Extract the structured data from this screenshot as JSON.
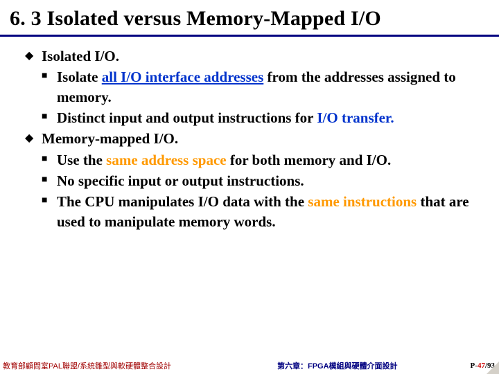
{
  "title": "6. 3 Isolated versus Memory-Mapped I/O",
  "items": [
    {
      "label": "Isolated I/O.",
      "sub": [
        {
          "parts": [
            {
              "t": "Isolate ",
              "c": ""
            },
            {
              "t": "all I/O interface addresses",
              "c": "hl-blue ul"
            },
            {
              "t": " from the addresses assigned to memory.",
              "c": ""
            }
          ]
        },
        {
          "parts": [
            {
              "t": "Distinct input and output instructions for ",
              "c": ""
            },
            {
              "t": "I/O transfer.",
              "c": "hl-blue"
            }
          ]
        }
      ]
    },
    {
      "label": "Memory-mapped I/O.",
      "sub": [
        {
          "parts": [
            {
              "t": "Use the ",
              "c": ""
            },
            {
              "t": "same address space",
              "c": "hl-orange"
            },
            {
              "t": " for both memory and I/O.",
              "c": ""
            }
          ]
        },
        {
          "parts": [
            {
              "t": "No specific input or output instructions.",
              "c": ""
            }
          ]
        },
        {
          "parts": [
            {
              "t": "The CPU manipulates I/O data with the ",
              "c": ""
            },
            {
              "t": "same instructions",
              "c": "hl-orange"
            },
            {
              "t": " that are used to manipulate memory words.",
              "c": ""
            }
          ]
        }
      ]
    }
  ],
  "footer": {
    "left": "教育部顧問室PAL聯盟/系統雛型與軟硬體整合設計",
    "right": "第六章：FPGA模組與硬體介面設計",
    "page_prefix": "P-",
    "page_current": "47",
    "page_sep": "/",
    "page_total": "93"
  }
}
